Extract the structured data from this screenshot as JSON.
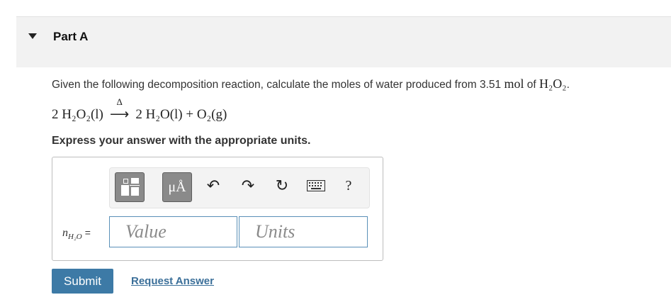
{
  "part": {
    "title": "Part A"
  },
  "question": {
    "prefix": "Given the following decomposition reaction, calculate the moles of water produced from 3.51 ",
    "unit": "mol",
    "of": " of ",
    "compound": "H₂O₂",
    "suffix": "."
  },
  "reaction": {
    "left": "2 H₂O₂(l)",
    "arrow_symbol": "⟶",
    "over_arrow": "Δ",
    "right": "2 H₂O(l) + O₂(g)"
  },
  "instruction": "Express your answer with the appropriate units.",
  "answer": {
    "variable": "n",
    "variable_sub": "H₂O",
    "equals": "=",
    "value_placeholder": "Value",
    "units_placeholder": "Units"
  },
  "toolbar": {
    "units_label": "μÅ",
    "undo_symbol": "↶",
    "redo_symbol": "↷",
    "reset_symbol": "↻",
    "help_label": "?",
    "icons": [
      "templates-icon",
      "units-icon",
      "undo-icon",
      "redo-icon",
      "reset-icon",
      "keyboard-icon",
      "help-icon"
    ]
  },
  "actions": {
    "submit_label": "Submit",
    "request_label": "Request Answer"
  },
  "colors": {
    "accent": "#3d7aa6",
    "link": "#3b6f99",
    "header_bg": "#f2f2f2",
    "input_border": "#5a90b8"
  }
}
